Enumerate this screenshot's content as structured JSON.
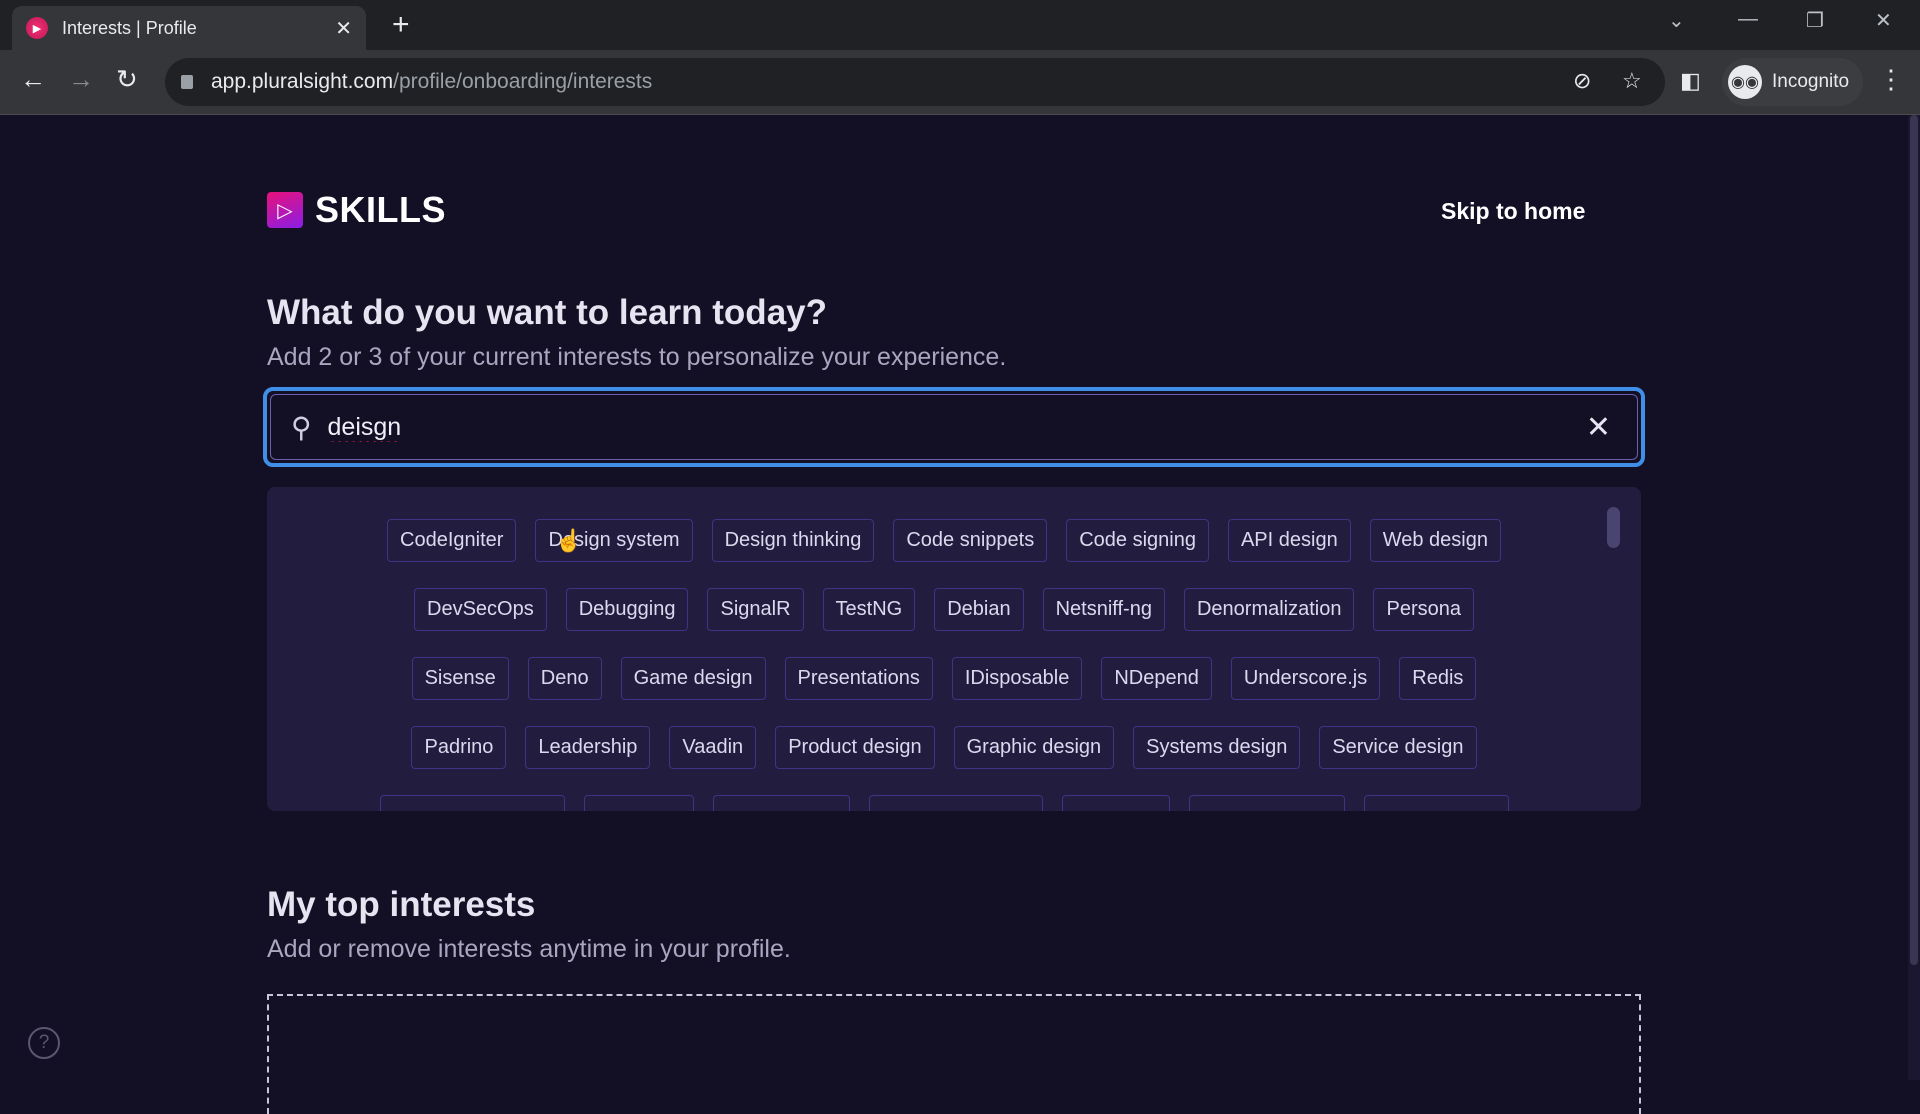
{
  "browser": {
    "tab_title": "Interests | Profile",
    "url_host": "app.pluralsight.com",
    "url_path": "/profile/onboarding/interests",
    "profile_label": "Incognito"
  },
  "header": {
    "logo_text": "SKILLS",
    "skip_label": "Skip to home"
  },
  "main": {
    "title": "What do you want to learn today?",
    "subtitle": "Add 2 or 3 of your current interests to personalize your experience.",
    "search": {
      "value": "deisgn"
    },
    "suggestion_rows": [
      [
        "CodeIgniter",
        "Design system",
        "Design thinking",
        "Code snippets",
        "Code signing",
        "API design",
        "Web design"
      ],
      [
        "DevSecOps",
        "Debugging",
        "SignalR",
        "TestNG",
        "Debian",
        "Netsniff-ng",
        "Denormalization",
        "Persona"
      ],
      [
        "Sisense",
        "Deno",
        "Game design",
        "Presentations",
        "IDisposable",
        "NDepend",
        "Underscore.js",
        "Redis"
      ],
      [
        "Padrino",
        "Leadership",
        "Vaadin",
        "Product design",
        "Graphic design",
        "Systems design",
        "Service design"
      ]
    ],
    "partial_row_count": 7
  },
  "interests": {
    "title": "My top interests",
    "subtitle": "Add or remove interests anytime in your profile."
  },
  "colors": {
    "accent": "#3f8fe8",
    "background": "#130f24",
    "panel": "#221d3f",
    "chip_border": "#3d3485"
  }
}
